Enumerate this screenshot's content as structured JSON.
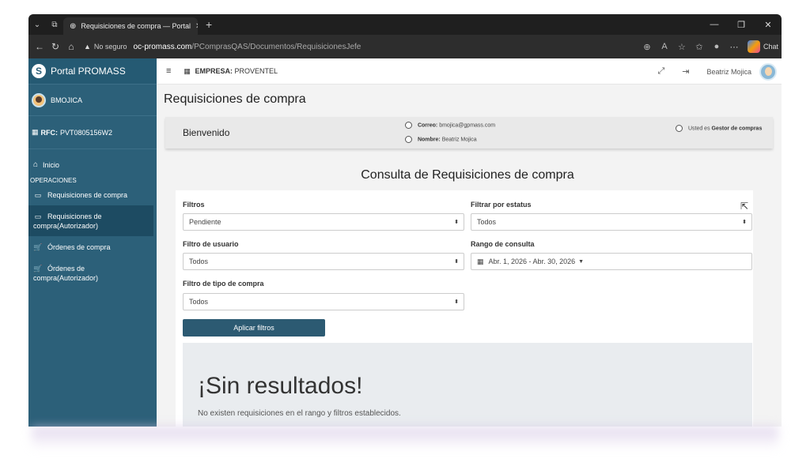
{
  "browser": {
    "tab_title": "Requisiciones de compra — Portal",
    "close": "✕",
    "new_tab": "+",
    "not_secure": "No seguro",
    "url_host": "oc-promass.com",
    "url_path": "/PComprasQAS/Documentos/RequisicionesJefe",
    "chat": "Chat"
  },
  "sidebar": {
    "brand": "Portal PROMASS",
    "user": "BMOJICA",
    "rfc_label": "RFC:",
    "rfc_value": "PVT0805156W2",
    "home": "Inicio",
    "section": "OPERACIONES",
    "items": [
      {
        "label": "Requisiciones de compra"
      },
      {
        "label": "Requisiciones de",
        "label2": "compra(Autorizador)"
      },
      {
        "label": "Órdenes de compra"
      },
      {
        "label": "Órdenes de",
        "label2": "compra(Autorizador)"
      }
    ]
  },
  "topbar": {
    "empresa_label": "EMPRESA:",
    "empresa_value": "PROVENTEL",
    "user_name": "Beatriz Mojica"
  },
  "page": {
    "title": "Requisiciones de compra",
    "welcome": "Bienvenido",
    "correo_label": "Correo:",
    "correo_value": "bmojica@gpmass.com",
    "nombre_label": "Nombre:",
    "nombre_value": "Beatriz Mojica",
    "role_prefix": "Usted es",
    "role_value": "Gestor de compras",
    "consulta_title": "Consulta de Requisiciones de compra"
  },
  "filters": {
    "filtros_label": "Filtros",
    "filtros_value": "Pendiente",
    "estatus_label": "Filtrar por estatus",
    "estatus_value": "Todos",
    "usuario_label": "Filtro de usuario",
    "usuario_value": "Todos",
    "rango_label": "Rango de consulta",
    "rango_value": "Abr. 1, 2026 - Abr. 30, 2026",
    "tipo_label": "Filtro de tipo de compra",
    "tipo_value": "Todos",
    "apply_label": "Aplicar filtros"
  },
  "empty": {
    "title": "¡Sin resultados!",
    "message": "No existen requisiciones en el rango y filtros establecidos."
  }
}
